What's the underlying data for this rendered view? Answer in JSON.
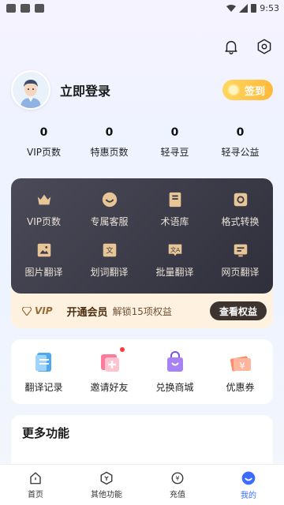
{
  "status_bar": {
    "time": "9:53"
  },
  "profile": {
    "login_label": "立即登录",
    "signin_label": "签到"
  },
  "stats": [
    {
      "value": "0",
      "label": "VIP页数"
    },
    {
      "value": "0",
      "label": "特惠页数"
    },
    {
      "value": "0",
      "label": "轻寻豆"
    },
    {
      "value": "0",
      "label": "轻寻公益"
    }
  ],
  "vip_features": [
    {
      "label": "VIP页数",
      "icon": "crown-icon"
    },
    {
      "label": "专属客服",
      "icon": "smile-service-icon"
    },
    {
      "label": "术语库",
      "icon": "term-book-icon"
    },
    {
      "label": "格式转换",
      "icon": "convert-icon"
    },
    {
      "label": "图片翻译",
      "icon": "image-translate-icon"
    },
    {
      "label": "划词翻译",
      "icon": "word-translate-icon"
    },
    {
      "label": "批量翻译",
      "icon": "batch-translate-icon"
    },
    {
      "label": "网页翻译",
      "icon": "web-translate-icon"
    }
  ],
  "vip_bar": {
    "tag": "VIP",
    "open_label": "开通会员",
    "unlock_text": "解锁15项权益",
    "button_label": "查看权益"
  },
  "quick_actions": [
    {
      "label": "翻译记录",
      "icon": "record-icon"
    },
    {
      "label": "邀请好友",
      "icon": "invite-icon"
    },
    {
      "label": "兑换商城",
      "icon": "mall-icon"
    },
    {
      "label": "优惠券",
      "icon": "coupon-icon"
    }
  ],
  "more_section": {
    "title": "更多功能"
  },
  "tabbar": [
    {
      "label": "首页",
      "icon": "home-icon"
    },
    {
      "label": "其他功能",
      "icon": "other-functions-icon"
    },
    {
      "label": "充值",
      "icon": "recharge-icon"
    },
    {
      "label": "我的",
      "icon": "profile-icon"
    }
  ],
  "colors": {
    "accent": "#3b6cff",
    "vip_dark": "#2f2f3c",
    "gold": "#ffb938"
  }
}
